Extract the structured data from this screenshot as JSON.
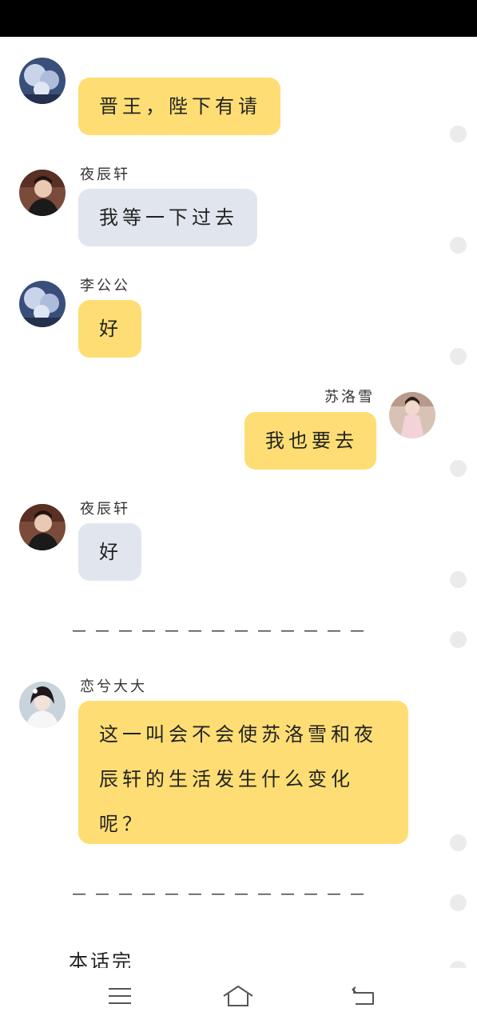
{
  "messages": [
    {
      "id": "m0",
      "sender": "",
      "side": "left",
      "text": "晋王，陛下有请",
      "color": "#fede74",
      "avatar": "blossom-tree-avatar"
    },
    {
      "id": "m1",
      "sender": "夜辰轩",
      "side": "left",
      "text": "我等一下过去",
      "color": "#e1e6ee",
      "avatar": "man-portrait-avatar"
    },
    {
      "id": "m2",
      "sender": "李公公",
      "side": "left",
      "text": "好",
      "color": "#fede74",
      "avatar": "blossom-tree-avatar"
    },
    {
      "id": "m3",
      "sender": "苏洛雪",
      "side": "right",
      "text": "我也要去",
      "color": "#fede74",
      "avatar": "woman-pink-dress-avatar"
    },
    {
      "id": "m4",
      "sender": "夜辰轩",
      "side": "left",
      "text": "好",
      "color": "#e1e6ee",
      "avatar": "man-portrait-avatar"
    },
    {
      "id": "m5",
      "sender": "恋兮大大",
      "side": "left",
      "text": "这一叫会不会使苏洛雪和夜辰轩的生活发生什么变化呢？",
      "color": "#fede74",
      "avatar": "woman-white-avatar"
    }
  ],
  "divider_text": "－－－－－－－－－－－－－",
  "end_text": "本话完",
  "nav": {
    "menu_icon": "menu-icon",
    "home_icon": "home-icon",
    "back_icon": "back-icon"
  },
  "colors": {
    "yellow_bubble": "#fede74",
    "gray_bubble": "#e1e6ee",
    "status_bar": "#000000"
  }
}
